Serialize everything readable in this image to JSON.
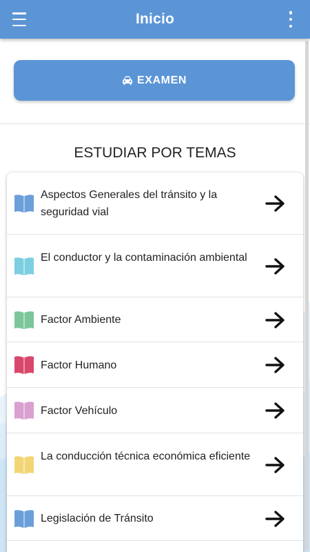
{
  "appbar": {
    "title": "Inicio",
    "menu_icon": "hamburger-menu-icon",
    "overflow_icon": "more-vertical-icon"
  },
  "exam_button": {
    "label": "EXAMEN",
    "icon": "car-icon"
  },
  "section_title": "ESTUDIAR POR TEMAS",
  "topics": [
    {
      "label": "Aspectos Generales del tránsito y la seguridad vial",
      "color": "#6b9fd9"
    },
    {
      "label": "El conductor y la contaminación ambiental",
      "color": "#7ccfe0"
    },
    {
      "label": "Factor Ambiente",
      "color": "#7cc69c"
    },
    {
      "label": "Factor Humano",
      "color": "#d9476a"
    },
    {
      "label": "Factor Vehículo",
      "color": "#d9a0d0"
    },
    {
      "label": "La conducción técnica económica eficiente",
      "color": "#f2d675"
    },
    {
      "label": "Legislación de Tránsito",
      "color": "#6b9fd9"
    }
  ],
  "colors": {
    "primary": "#5b95d6",
    "text": "#222222"
  }
}
